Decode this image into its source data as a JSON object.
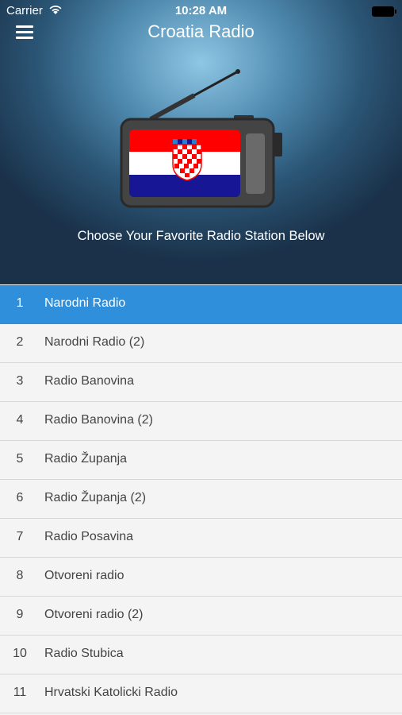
{
  "status_bar": {
    "carrier": "Carrier",
    "time": "10:28 AM"
  },
  "header": {
    "title": "Croatia Radio",
    "subtitle": "Choose Your Favorite Radio Station Below"
  },
  "stations": [
    {
      "num": "1",
      "name": "Narodni Radio",
      "selected": true
    },
    {
      "num": "2",
      "name": "Narodni Radio (2)"
    },
    {
      "num": "3",
      "name": "Radio Banovina"
    },
    {
      "num": "4",
      "name": "Radio Banovina (2)"
    },
    {
      "num": "5",
      "name": "Radio Županja"
    },
    {
      "num": "6",
      "name": "Radio Županja (2)"
    },
    {
      "num": "7",
      "name": "Radio Posavina"
    },
    {
      "num": "8",
      "name": "Otvoreni radio"
    },
    {
      "num": "9",
      "name": "Otvoreni radio (2)"
    },
    {
      "num": "10",
      "name": "Radio Stubica"
    },
    {
      "num": "11",
      "name": "Hrvatski Katolicki Radio"
    }
  ],
  "colors": {
    "accent": "#2f8fdb",
    "flag_red": "#ff0000",
    "flag_blue": "#171796"
  }
}
